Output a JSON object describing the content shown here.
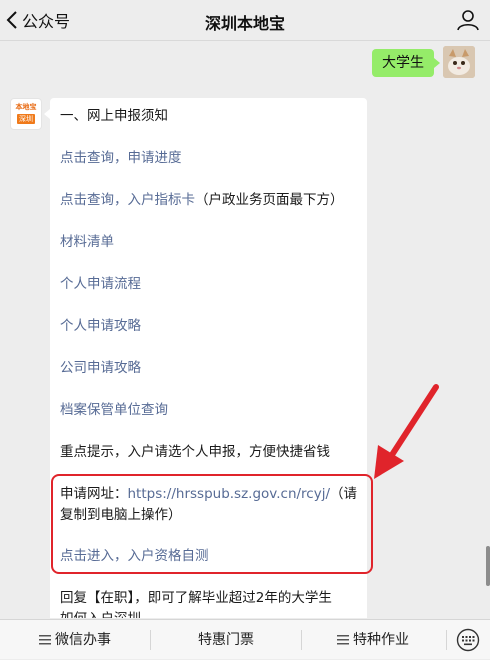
{
  "header": {
    "back_label": "公众号",
    "title": "深圳本地宝"
  },
  "user_message": "大学生",
  "bot_avatar_text_top": "本地宝",
  "bot_avatar_text_bottom": "深圳",
  "bot_message": {
    "lines": [
      {
        "text": "一、网上申报须知",
        "style": "plain"
      },
      {
        "text": "点击查询，申请进度",
        "style": "link"
      },
      {
        "text": "点击查询，入户指标卡",
        "style": "link",
        "suffix": "（户政业务页面最下方）"
      },
      {
        "text": "材料清单",
        "style": "link"
      },
      {
        "text": "个人申请流程",
        "style": "link"
      },
      {
        "text": "个人申请攻略",
        "style": "link"
      },
      {
        "text": "公司申请攻略",
        "style": "link"
      },
      {
        "text": "档案保管单位查询",
        "style": "link"
      },
      {
        "text": "重点提示，入户请选个人申报，方便快捷省钱",
        "style": "plain"
      }
    ],
    "apply_prefix": "申请网址：",
    "apply_url": "https://hrsspub.sz.gov.cn/rcyj/",
    "apply_suffix_1": "（请",
    "apply_suffix_2": "复制到电脑上操作）",
    "self_test_link": "点击进入，入户资格自测",
    "reply_hint_1": "回复【在职】，即可了解毕业超过2年的大学生",
    "reply_hint_2": "如何入户深圳"
  },
  "bottom_menu": {
    "items": [
      "微信办事",
      "特惠门票",
      "特种作业"
    ]
  },
  "colors": {
    "user_bubble": "#95ec69",
    "link": "#576b95",
    "highlight": "#e0242b"
  }
}
